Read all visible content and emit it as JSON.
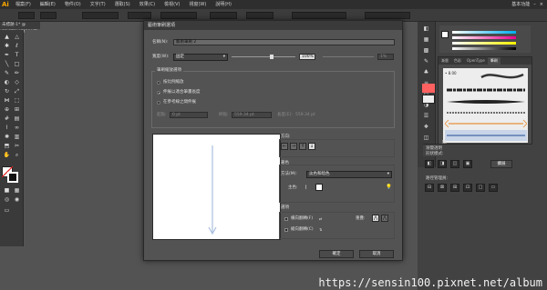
{
  "app": {
    "logo": "Ai",
    "menus": [
      "檔案(F)",
      "編輯(E)",
      "物件(O)",
      "文字(T)",
      "選取(S)",
      "效果(C)",
      "檢視(V)",
      "視窗(W)",
      "說明(H)"
    ],
    "workspace": "基本功能",
    "document_tab": "未標題-1* @ 66.67% (CMYK/預視)"
  },
  "dialog": {
    "title": "藝術筆刷選項",
    "name_label": "名稱(N):",
    "name_value": "藝術筆刷 2",
    "width_label": "寬度(W):",
    "width_option": "固定",
    "width_percent": "100%",
    "width_max": "1%",
    "scale_group_title": "筆刷縮放選項",
    "scale_options": [
      {
        "label": "按比例縮放",
        "selected": false
      },
      {
        "label": "伸展以適合筆畫長度",
        "selected": true
      },
      {
        "label": "在參考線之間伸展",
        "selected": false
      }
    ],
    "guide_start_label": "起點:",
    "guide_start_value": "0 pt",
    "guide_end_label": "終點:",
    "guide_end_value": "559.34 pt",
    "guide_length_label": "長度(E):",
    "guide_length_value": "559.34 pt",
    "direction_label": "方向:",
    "colorize_title": "著色",
    "method_label": "方法(M):",
    "method_value": "淡色和暗色",
    "key_color_label": "主色:",
    "options_title": "選項",
    "flip_along_label": "橫向翻轉(F)",
    "flip_across_label": "縱向翻轉(C)",
    "overlap_label": "重疊:",
    "ok_label": "確定",
    "cancel_label": "取消",
    "preview_stroke_color": "#a9bfe0"
  },
  "panels": {
    "brush_tabs": [
      "漸層",
      "色彩",
      "OpenType",
      "筆刷"
    ],
    "brush_size_label": "8.00",
    "transparency_label": "漸變透明",
    "shape_mode_label": "形狀模式:",
    "pathfinder_label": "路徑管理員:",
    "expand_label": "擴展",
    "pathfinder_tab": "路徑管理員"
  },
  "watermark": "https://sensin100.pixnet.net/album",
  "colors": {
    "app_bg": "#535353",
    "dialog_bg": "#535353",
    "accent_orange": "#e8a25a",
    "stroke_blue": "#a9bfe0"
  }
}
